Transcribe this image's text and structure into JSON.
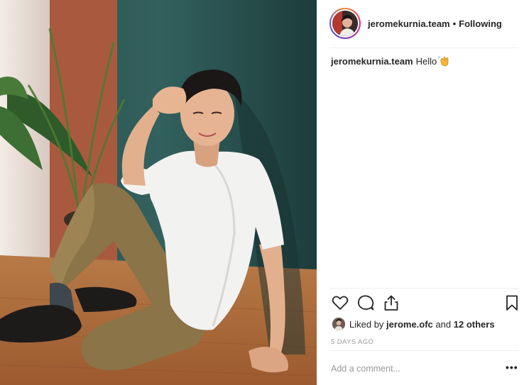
{
  "post": {
    "author": "jeromekurnia.team",
    "follow_separator": "•",
    "follow_status": "Following",
    "caption_text": "Hello",
    "caption_emoji_icon": "waving-hand-icon",
    "liked_by_prefix": "Liked by",
    "liked_by_user": "jerome.ofc",
    "liked_by_suffix_and": "and",
    "liked_by_others": "12 others",
    "timestamp": "5 DAYS AGO",
    "comment_placeholder": "Add a comment...",
    "more_options_label": "•••"
  },
  "icons": {
    "like": "heart-icon",
    "comment": "comment-bubble-icon",
    "share": "share-icon",
    "save": "bookmark-icon"
  },
  "colors": {
    "wall": "#2f5a57",
    "floor": "#b06a3a",
    "shirt": "#f2f2f0",
    "pants": "#8a7448",
    "story_ring": [
      "#f58529",
      "#dd2a7b",
      "#8134af",
      "#515bd4"
    ],
    "meta_text": "#999999"
  }
}
